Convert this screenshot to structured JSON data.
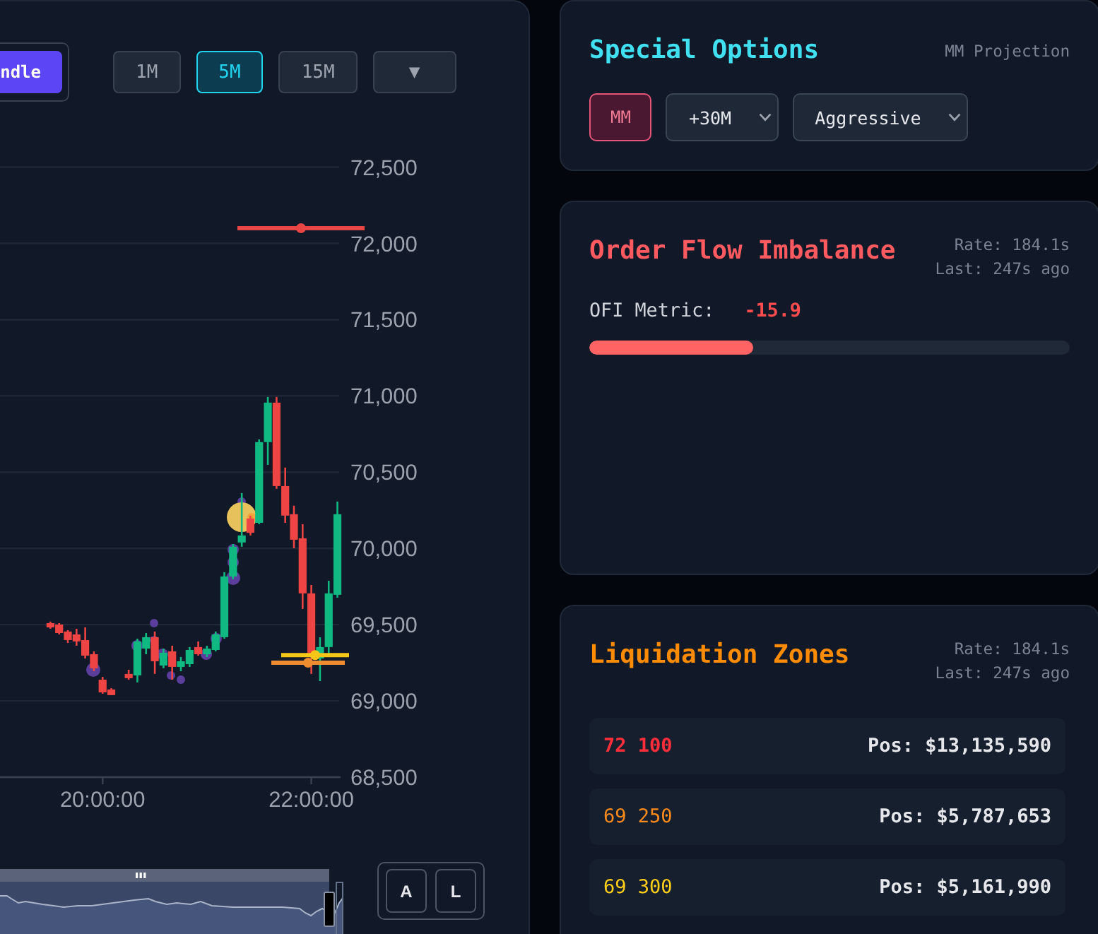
{
  "chart_panel": {
    "chart_type_button": {
      "label": "ndle",
      "selected": true
    },
    "timeframes": [
      {
        "label": "1M",
        "selected": false
      },
      {
        "label": "5M",
        "selected": true
      },
      {
        "label": "15M",
        "selected": false
      }
    ],
    "dropdown_button": {
      "label": "▼"
    },
    "chart_data": {
      "type": "candlestick",
      "x": [
        1170,
        1175,
        1180,
        1185,
        1190,
        1195,
        1200,
        1205,
        1215,
        1220,
        1225,
        1230,
        1235,
        1240,
        1245,
        1250,
        1255,
        1260,
        1265,
        1270,
        1275,
        1280,
        1285,
        1290,
        1295,
        1300,
        1305,
        1310,
        1315,
        1320,
        1325,
        1330,
        1335
      ],
      "ohlc": [
        [
          69510,
          69520,
          69473,
          69482
        ],
        [
          69501,
          69510,
          69436,
          69445
        ],
        [
          69455,
          69464,
          69380,
          69399
        ],
        [
          69436,
          69473,
          69362,
          69390
        ],
        [
          69399,
          69482,
          69278,
          69297
        ],
        [
          69306,
          69325,
          69195,
          69214
        ],
        [
          69139,
          69158,
          69047,
          69056
        ],
        [
          69075,
          69084,
          69038,
          69038
        ],
        [
          69177,
          69204,
          69139,
          69149
        ],
        [
          69167,
          69408,
          69121,
          69390
        ],
        [
          69343,
          69445,
          69306,
          69418
        ],
        [
          69418,
          69455,
          69177,
          69260
        ],
        [
          69232,
          69343,
          69214,
          69316
        ],
        [
          69325,
          69362,
          69139,
          69223
        ],
        [
          69223,
          69288,
          69195,
          69260
        ],
        [
          69241,
          69353,
          69223,
          69334
        ],
        [
          69353,
          69390,
          69297,
          69306
        ],
        [
          69306,
          69362,
          69288,
          69343
        ],
        [
          69334,
          69455,
          69325,
          69436
        ],
        [
          69418,
          69844,
          69408,
          69816
        ],
        [
          69816,
          70029,
          69798,
          70011
        ],
        [
          70039,
          70363,
          70011,
          70085
        ],
        [
          70196,
          70215,
          70085,
          70103
        ],
        [
          70168,
          70715,
          70159,
          70697
        ],
        [
          70697,
          70993,
          70548,
          70956
        ],
        [
          70956,
          70993,
          70391,
          70409
        ],
        [
          70409,
          70530,
          70168,
          70215
        ],
        [
          70224,
          70280,
          70001,
          70057
        ],
        [
          70066,
          70159,
          69603,
          69705
        ],
        [
          69705,
          69760,
          69177,
          69297
        ],
        [
          69278,
          69418,
          69130,
          69353
        ],
        [
          69353,
          69788,
          69297,
          69705
        ],
        [
          69696,
          70307,
          69677,
          70224
        ]
      ],
      "xlim": [
        1141,
        1336
      ],
      "ylim": [
        68500,
        72500
      ],
      "xticks": [
        {
          "value": 1200,
          "label": "20:00:00"
        },
        {
          "value": 1320,
          "label": "22:00:00"
        }
      ],
      "yticks": [
        {
          "value": 72500,
          "label": "72,500"
        },
        {
          "value": 72000,
          "label": "72,000"
        },
        {
          "value": 71500,
          "label": "71,500"
        },
        {
          "value": 71000,
          "label": "71,000"
        },
        {
          "value": 70500,
          "label": "70,500"
        },
        {
          "value": 70000,
          "label": "70,000"
        },
        {
          "value": 69500,
          "label": "69,500"
        },
        {
          "value": 69000,
          "label": "69,000"
        },
        {
          "value": 68500,
          "label": "68,500"
        }
      ],
      "grid": true,
      "ref_lines": [
        {
          "axis": "y",
          "value": 72100,
          "color": "#e84545"
        },
        {
          "axis": "y",
          "value": 69250,
          "color": "#f08c30"
        },
        {
          "axis": "y",
          "value": 69300,
          "color": "#f5c518"
        }
      ]
    },
    "mode_buttons": [
      {
        "label": "A"
      },
      {
        "label": "L"
      }
    ]
  },
  "special_options": {
    "title": "Special Options",
    "subtitle": "MM Projection",
    "toggle": {
      "label": "MM",
      "on": true
    },
    "selects": [
      {
        "value": "+30M"
      },
      {
        "value": "Aggressive"
      }
    ]
  },
  "order_flow_imbalance": {
    "title": "Order Flow Imbalance",
    "rate": "Rate: 184.1s",
    "last": "Last: 247s ago",
    "metric_label": "OFI Metric:",
    "metric_value": "-15.9",
    "meter": {
      "level": 0.34
    }
  },
  "liquidation_zones": {
    "title": "Liquidation Zones",
    "rate": "Rate: 184.1s",
    "last": "Last: 247s ago",
    "rows": [
      {
        "price": "72 100",
        "position": "Pos: $13,135,590",
        "color": "#ff2e3b",
        "emphasized": true
      },
      {
        "price": "69 250",
        "position": "Pos: $5,787,653",
        "color": "#ff8a1c",
        "emphasized": false
      },
      {
        "price": "69 300",
        "position": "Pos: $5,161,990",
        "color": "#ffcf1a",
        "emphasized": false
      }
    ]
  }
}
